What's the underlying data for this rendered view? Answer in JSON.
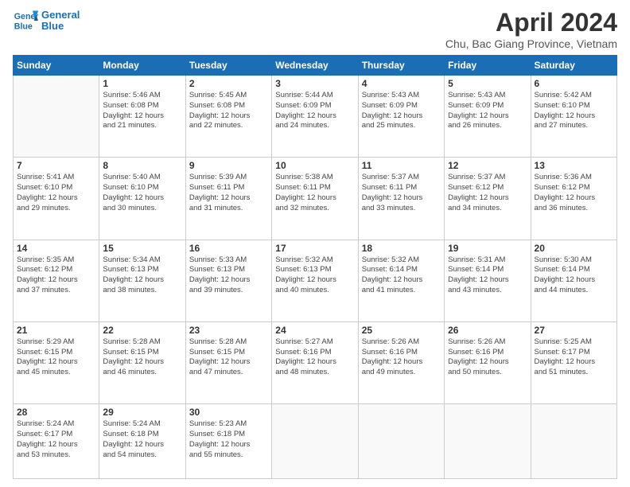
{
  "logo": {
    "line1": "General",
    "line2": "Blue"
  },
  "title": "April 2024",
  "subtitle": "Chu, Bac Giang Province, Vietnam",
  "days_of_week": [
    "Sunday",
    "Monday",
    "Tuesday",
    "Wednesday",
    "Thursday",
    "Friday",
    "Saturday"
  ],
  "weeks": [
    [
      {
        "num": "",
        "info": ""
      },
      {
        "num": "1",
        "info": "Sunrise: 5:46 AM\nSunset: 6:08 PM\nDaylight: 12 hours\nand 21 minutes."
      },
      {
        "num": "2",
        "info": "Sunrise: 5:45 AM\nSunset: 6:08 PM\nDaylight: 12 hours\nand 22 minutes."
      },
      {
        "num": "3",
        "info": "Sunrise: 5:44 AM\nSunset: 6:09 PM\nDaylight: 12 hours\nand 24 minutes."
      },
      {
        "num": "4",
        "info": "Sunrise: 5:43 AM\nSunset: 6:09 PM\nDaylight: 12 hours\nand 25 minutes."
      },
      {
        "num": "5",
        "info": "Sunrise: 5:43 AM\nSunset: 6:09 PM\nDaylight: 12 hours\nand 26 minutes."
      },
      {
        "num": "6",
        "info": "Sunrise: 5:42 AM\nSunset: 6:10 PM\nDaylight: 12 hours\nand 27 minutes."
      }
    ],
    [
      {
        "num": "7",
        "info": "Sunrise: 5:41 AM\nSunset: 6:10 PM\nDaylight: 12 hours\nand 29 minutes."
      },
      {
        "num": "8",
        "info": "Sunrise: 5:40 AM\nSunset: 6:10 PM\nDaylight: 12 hours\nand 30 minutes."
      },
      {
        "num": "9",
        "info": "Sunrise: 5:39 AM\nSunset: 6:11 PM\nDaylight: 12 hours\nand 31 minutes."
      },
      {
        "num": "10",
        "info": "Sunrise: 5:38 AM\nSunset: 6:11 PM\nDaylight: 12 hours\nand 32 minutes."
      },
      {
        "num": "11",
        "info": "Sunrise: 5:37 AM\nSunset: 6:11 PM\nDaylight: 12 hours\nand 33 minutes."
      },
      {
        "num": "12",
        "info": "Sunrise: 5:37 AM\nSunset: 6:12 PM\nDaylight: 12 hours\nand 34 minutes."
      },
      {
        "num": "13",
        "info": "Sunrise: 5:36 AM\nSunset: 6:12 PM\nDaylight: 12 hours\nand 36 minutes."
      }
    ],
    [
      {
        "num": "14",
        "info": "Sunrise: 5:35 AM\nSunset: 6:12 PM\nDaylight: 12 hours\nand 37 minutes."
      },
      {
        "num": "15",
        "info": "Sunrise: 5:34 AM\nSunset: 6:13 PM\nDaylight: 12 hours\nand 38 minutes."
      },
      {
        "num": "16",
        "info": "Sunrise: 5:33 AM\nSunset: 6:13 PM\nDaylight: 12 hours\nand 39 minutes."
      },
      {
        "num": "17",
        "info": "Sunrise: 5:32 AM\nSunset: 6:13 PM\nDaylight: 12 hours\nand 40 minutes."
      },
      {
        "num": "18",
        "info": "Sunrise: 5:32 AM\nSunset: 6:14 PM\nDaylight: 12 hours\nand 41 minutes."
      },
      {
        "num": "19",
        "info": "Sunrise: 5:31 AM\nSunset: 6:14 PM\nDaylight: 12 hours\nand 43 minutes."
      },
      {
        "num": "20",
        "info": "Sunrise: 5:30 AM\nSunset: 6:14 PM\nDaylight: 12 hours\nand 44 minutes."
      }
    ],
    [
      {
        "num": "21",
        "info": "Sunrise: 5:29 AM\nSunset: 6:15 PM\nDaylight: 12 hours\nand 45 minutes."
      },
      {
        "num": "22",
        "info": "Sunrise: 5:28 AM\nSunset: 6:15 PM\nDaylight: 12 hours\nand 46 minutes."
      },
      {
        "num": "23",
        "info": "Sunrise: 5:28 AM\nSunset: 6:15 PM\nDaylight: 12 hours\nand 47 minutes."
      },
      {
        "num": "24",
        "info": "Sunrise: 5:27 AM\nSunset: 6:16 PM\nDaylight: 12 hours\nand 48 minutes."
      },
      {
        "num": "25",
        "info": "Sunrise: 5:26 AM\nSunset: 6:16 PM\nDaylight: 12 hours\nand 49 minutes."
      },
      {
        "num": "26",
        "info": "Sunrise: 5:26 AM\nSunset: 6:16 PM\nDaylight: 12 hours\nand 50 minutes."
      },
      {
        "num": "27",
        "info": "Sunrise: 5:25 AM\nSunset: 6:17 PM\nDaylight: 12 hours\nand 51 minutes."
      }
    ],
    [
      {
        "num": "28",
        "info": "Sunrise: 5:24 AM\nSunset: 6:17 PM\nDaylight: 12 hours\nand 53 minutes."
      },
      {
        "num": "29",
        "info": "Sunrise: 5:24 AM\nSunset: 6:18 PM\nDaylight: 12 hours\nand 54 minutes."
      },
      {
        "num": "30",
        "info": "Sunrise: 5:23 AM\nSunset: 6:18 PM\nDaylight: 12 hours\nand 55 minutes."
      },
      {
        "num": "",
        "info": ""
      },
      {
        "num": "",
        "info": ""
      },
      {
        "num": "",
        "info": ""
      },
      {
        "num": "",
        "info": ""
      }
    ]
  ]
}
